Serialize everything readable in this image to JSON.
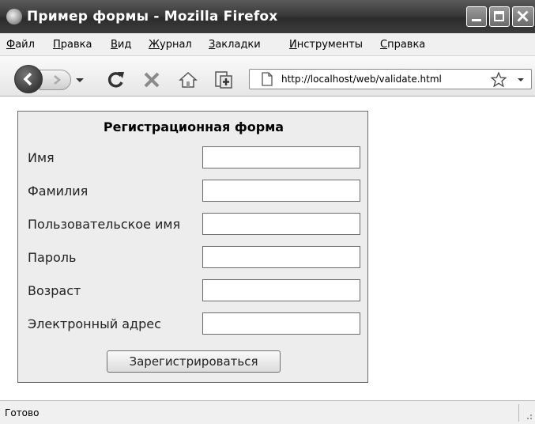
{
  "window": {
    "title": "Пример формы - Mozilla Firefox"
  },
  "menu": {
    "items": [
      {
        "label": "Файл"
      },
      {
        "label": "Правка"
      },
      {
        "label": "Вид"
      },
      {
        "label": "Журнал"
      },
      {
        "label": "Закладки"
      },
      {
        "label": "Инструменты"
      },
      {
        "label": "Справка"
      }
    ]
  },
  "toolbar": {
    "url": "http://localhost/web/validate.html",
    "icons": [
      "back-icon",
      "forward-icon",
      "history-dropdown-icon",
      "reload-icon",
      "stop-icon",
      "home-icon",
      "bookmark-page-icon",
      "page-icon",
      "star-icon",
      "url-dropdown-icon"
    ]
  },
  "form": {
    "title": "Регистрационная форма",
    "fields": [
      {
        "label": "Имя",
        "value": ""
      },
      {
        "label": "Фамилия",
        "value": ""
      },
      {
        "label": "Пользовательское имя",
        "value": ""
      },
      {
        "label": "Пароль",
        "value": ""
      },
      {
        "label": "Возраст",
        "value": ""
      },
      {
        "label": "Электронный адрес",
        "value": ""
      }
    ],
    "submit_label": "Зарегистрироваться"
  },
  "status": {
    "text": "Готово"
  }
}
